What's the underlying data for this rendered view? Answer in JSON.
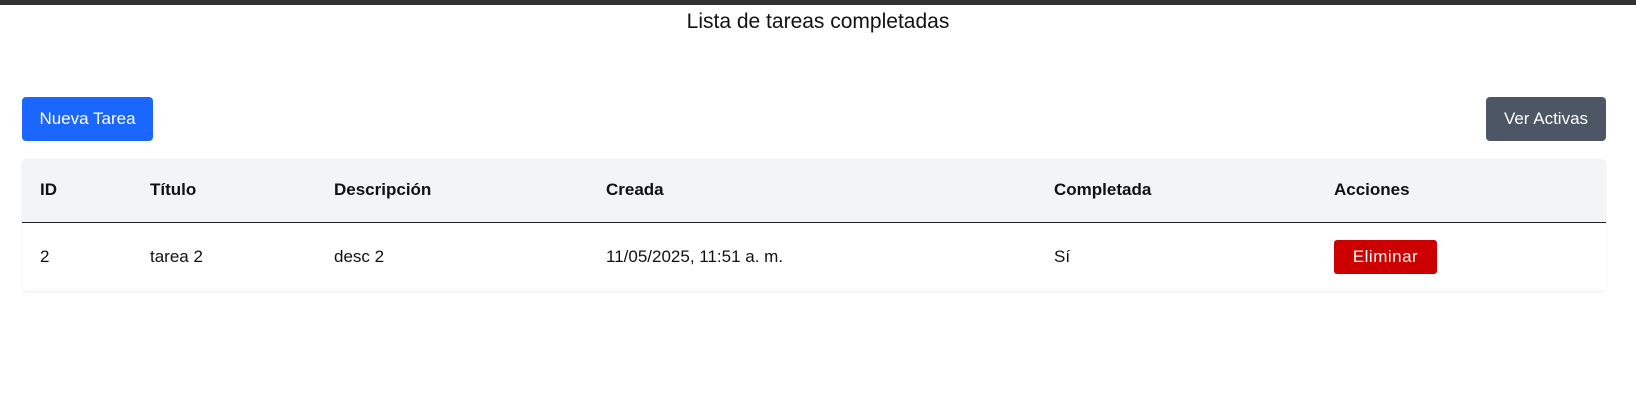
{
  "page": {
    "title": "Lista de tareas completadas"
  },
  "toolbar": {
    "new_task_label": "Nueva Tarea",
    "view_active_label": "Ver Activas"
  },
  "table": {
    "headers": [
      "ID",
      "Título",
      "Descripción",
      "Creada",
      "Completada",
      "Acciones"
    ],
    "rows": [
      {
        "id": "2",
        "title": "tarea 2",
        "description": "desc 2",
        "created": "11/05/2025, 11:51 a. m.",
        "completed": "Sí",
        "delete_label": "Eliminar"
      }
    ]
  },
  "colors": {
    "primary": "#1a66ff",
    "secondary": "#4c5664",
    "danger": "#cc0000",
    "header_bg": "#f3f4f6"
  }
}
